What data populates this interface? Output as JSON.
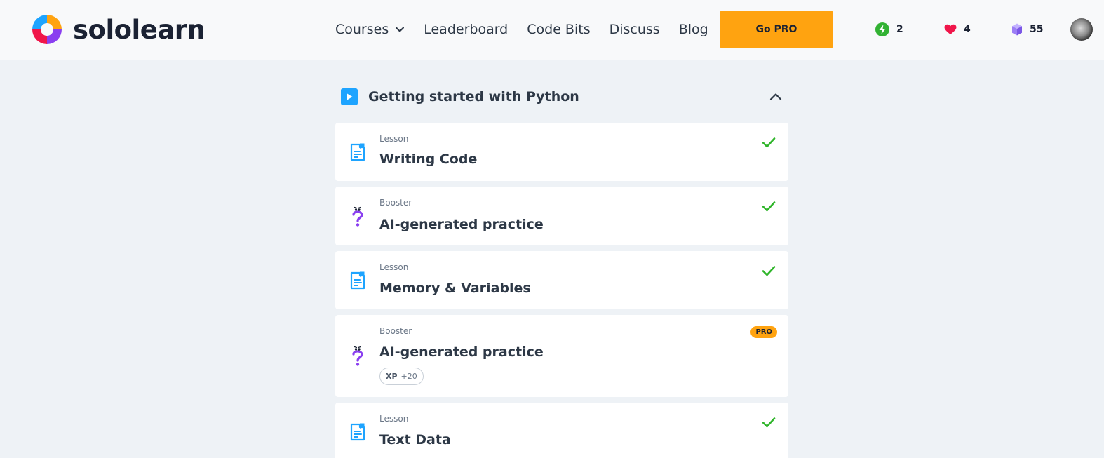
{
  "brand": {
    "name": "sololearn"
  },
  "nav": {
    "items": [
      "Courses",
      "Leaderboard",
      "Code Bits",
      "Discuss",
      "Blog"
    ],
    "cta": "Go PRO"
  },
  "stats": {
    "streak": "2",
    "hearts": "4",
    "bits": "55"
  },
  "section": {
    "title": "Getting started with Python"
  },
  "cards": [
    {
      "type": "Lesson",
      "title": "Writing Code",
      "status": "completed"
    },
    {
      "type": "Booster",
      "title": "AI-generated practice",
      "status": "completed"
    },
    {
      "type": "Lesson",
      "title": "Memory & Variables",
      "status": "completed"
    },
    {
      "type": "Booster",
      "title": "AI-generated practice",
      "status": "pro",
      "badge": "PRO",
      "xp_label": "XP",
      "xp_value": "+20"
    },
    {
      "type": "Lesson",
      "title": "Text Data",
      "status": "completed"
    }
  ],
  "colors": {
    "accent": "#ffa310",
    "check": "#2fb52a",
    "lesson_icon": "#1ea4ff",
    "booster_icon": "#8a3ff0",
    "heart": "#f0164a",
    "streak": "#32b233",
    "bits": "#9c7ef5"
  }
}
